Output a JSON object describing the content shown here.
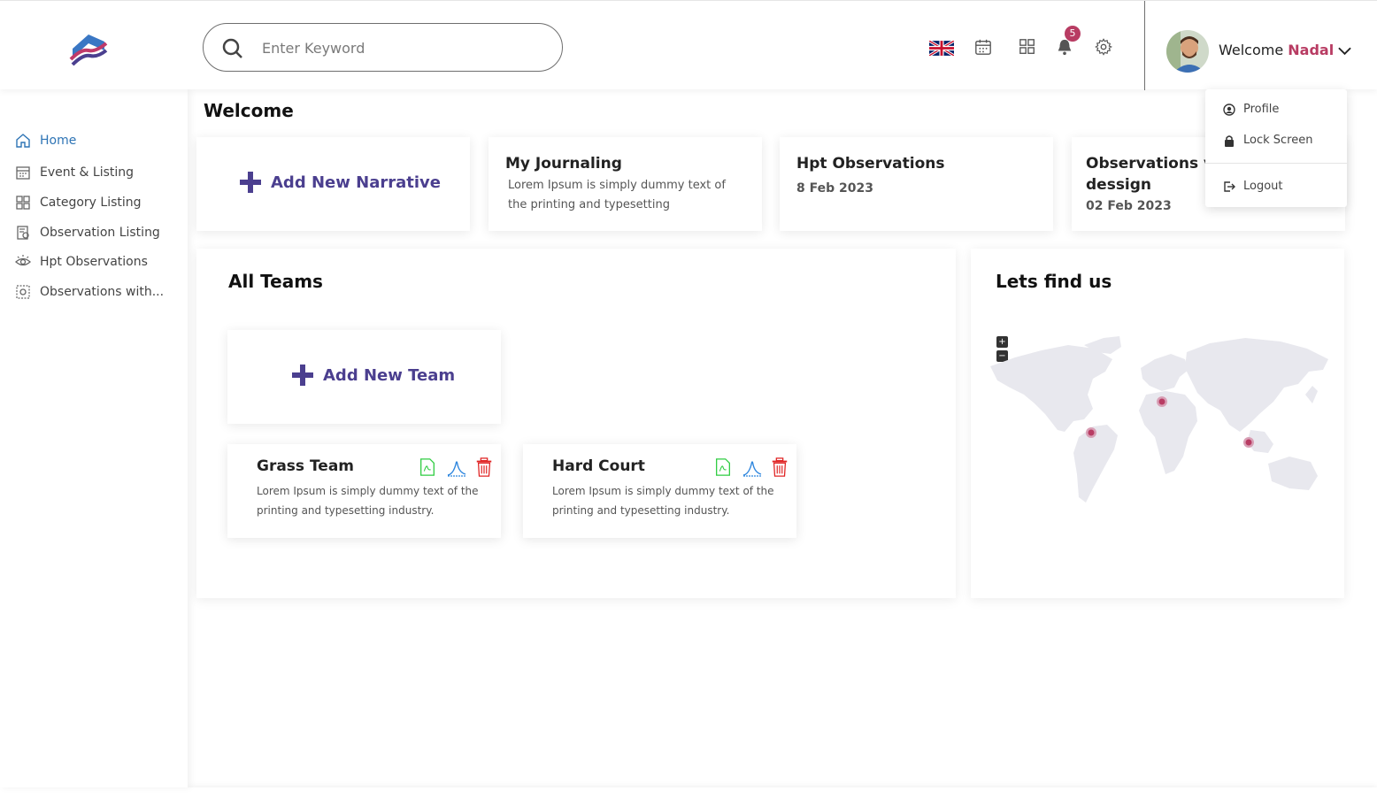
{
  "search": {
    "placeholder": "Enter Keyword"
  },
  "header": {
    "notification_count": "5",
    "welcome_prefix": "Welcome",
    "user_name": "Nadal"
  },
  "sidebar": {
    "items": [
      {
        "label": "Home",
        "icon": "home-icon",
        "active": true
      },
      {
        "label": "Event & Listing",
        "icon": "calendar-icon"
      },
      {
        "label": "Category Listing",
        "icon": "grid-icon"
      },
      {
        "label": "Observation Listing",
        "icon": "observation-list-icon"
      },
      {
        "label": "Hpt Observations",
        "icon": "eye-icon"
      },
      {
        "label": "Observations with...",
        "icon": "observation-icon"
      }
    ]
  },
  "main": {
    "title": "Welcome",
    "cards": [
      {
        "action": "Add New Narrative"
      },
      {
        "title": "My Journaling",
        "text": "Lorem Ipsum is simply dummy text of the printing and typesetting"
      },
      {
        "title": "Hpt Observations",
        "date": "8 Feb 2023"
      },
      {
        "title": "Observations v",
        "title_line2": "dessign",
        "date": "02 Feb 2023"
      }
    ],
    "teams": {
      "title": "All Teams",
      "add_label": "Add New Team",
      "items": [
        {
          "name": "Grass Team",
          "desc": "Lorem Ipsum is simply dummy text of the printing and typesetting industry."
        },
        {
          "name": "Hard Court",
          "desc": "Lorem Ipsum is simply dummy text of the printing and typesetting industry."
        }
      ]
    },
    "map": {
      "title": "Lets find us",
      "zoom_in": "+",
      "zoom_out": "−",
      "marker_color": "#b83c63"
    }
  },
  "dropdown": {
    "items": [
      {
        "label": "Profile",
        "icon": "profile-icon"
      },
      {
        "label": "Lock Screen",
        "icon": "lock-icon"
      },
      {
        "label": "Logout",
        "icon": "logout-icon"
      }
    ]
  },
  "colors": {
    "accent": "#4b3f8f",
    "active_nav": "#2e74b5",
    "badge": "#b83c63",
    "pdf_icon": "#2ecc40",
    "chart_icon": "#2e86de",
    "delete_icon": "#e02424"
  }
}
